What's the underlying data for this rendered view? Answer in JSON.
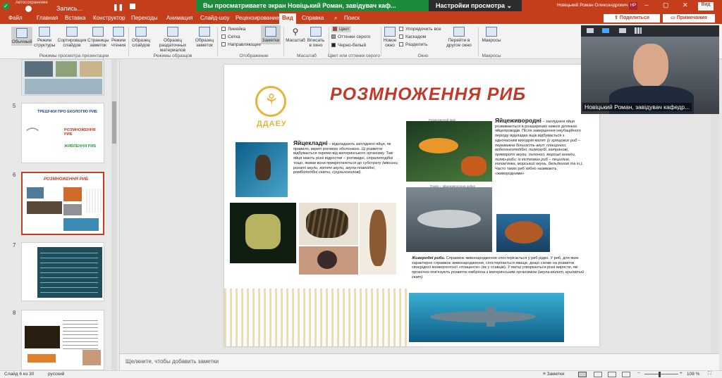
{
  "titlebar": {
    "autosave": "Автосохранение",
    "recording": "Запись...",
    "user": "Новіцький Роман Олександрович",
    "user_initials": "НР",
    "banner_text": "Вы просматриваете экран Новіцький Роман, завідувач каф...",
    "view_settings": "Настройки просмотра",
    "view_label": "Вид"
  },
  "tabs": [
    "Файл",
    "Главная",
    "Вставка",
    "Конструктор",
    "Переходы",
    "Анимация",
    "Слайд-шоу",
    "Рецензирование",
    "Вид",
    "Справка",
    "Поиск"
  ],
  "active_tab": "Вид",
  "share": "Поделиться",
  "comments": "Примечания",
  "ribbon": {
    "buttons": [
      "Обычный",
      "Режим структуры",
      "Сортировщик слайдов",
      "Страницы заметок",
      "Режим чтения",
      "Образец слайдов",
      "Образец раздаточных материалов",
      "Образец заметок",
      "Заметки",
      "Масштаб",
      "Вписать в окно",
      "Новое окно",
      "Перейти в другое окно",
      "Макросы"
    ],
    "checkboxes": [
      "Линейка",
      "Сетка",
      "Направляющие"
    ],
    "color_options": [
      "Цвет",
      "Оттенки серого",
      "Черно-белый"
    ],
    "window_options": [
      "Упорядочить все",
      "Каскадом",
      "Разделить"
    ],
    "groups": [
      "Режимы просмотра презентации",
      "Режимы образцов",
      "Отображение",
      "Масштаб",
      "Цвет или оттенки серого",
      "Окно",
      "Макросы"
    ]
  },
  "thumbnails": [
    {
      "num": "5",
      "title": "ТРЕШЧКИ ПРО ЕКОЛОГІЮ РИБ",
      "items": [
        "РОЗМНОЖЕННЯ РИБ",
        "ЖИВЛЕННЯ РИБ"
      ]
    },
    {
      "num": "6",
      "title": "РОЗМНОЖЕННЯ РИБ"
    },
    {
      "num": "7"
    },
    {
      "num": "8"
    }
  ],
  "slide": {
    "title": "РОЗМНОЖЕННЯ РИБ",
    "logo": "ДДАЕУ",
    "section1_head": "Яйцекладні",
    "section1_text": "– відкладають запліднені яйця, як правило, вкриті роговою оболонкою. Ці розвиток відбувається окремо від материнського організму. Такі яйця мають різні відростки – роговидні, спіралеподібні тощо, якими вони прикріплюються до субстрату",
    "section1_examples": "(міксини, рогаті акули, котячі акули, акула-плакоїдні, ромбоподібні скати, суцільноголові).",
    "caption1": "Розмножений виді",
    "caption2": "Гецкія – яйцеживородна рибка",
    "section2_head": "Яйцеживородні",
    "section2_text": "– запліднені яйця розвиваються в розширених нижніх ділянках яйцепроводів. Після завершення інкубаційного періоду відкладка ящік відбувається з одночасним виходом малят",
    "section2_examples": "(у хрящових риб – переважна більшість акул: плащоносі, вобегонгоподібні, пилкозубі, катранові, прямороті акули, пилоносі, морські ангели, пилки-риби; із кісткових риб – пецилієві, голом'янка, морський окунь, бельдюгові та ін.).",
    "section2_note": "Часто таких риб хибно називають «живородними»",
    "section3_head": "Живородні риби.",
    "section3_text": "Справжнє живонародження спостерігається у риб рідко. У риб, для яких характерне справжнє живонародження, спостерігається явище, дещо схоже на розвиток своєрідної конвергентної «плаценти» (як у ссавців). У матці утворюються різні вирости, які органічно пов'язують розвиток ембріона з материнським організмом",
    "section3_examples": "(акула-молот, крилатий скат)."
  },
  "notes_placeholder": "Щелкните, чтобы добавить заметки",
  "status": {
    "slide": "Слайд 6 из 30",
    "language": "русский",
    "notes": "Заметки",
    "zoom": "108 %"
  },
  "video": {
    "caption": "Новіцький Роман, завідувач кафедр..."
  },
  "colors": {
    "accent": "#c43e1c",
    "title_red": "#c0392b",
    "green_banner": "#1e8a3c"
  }
}
